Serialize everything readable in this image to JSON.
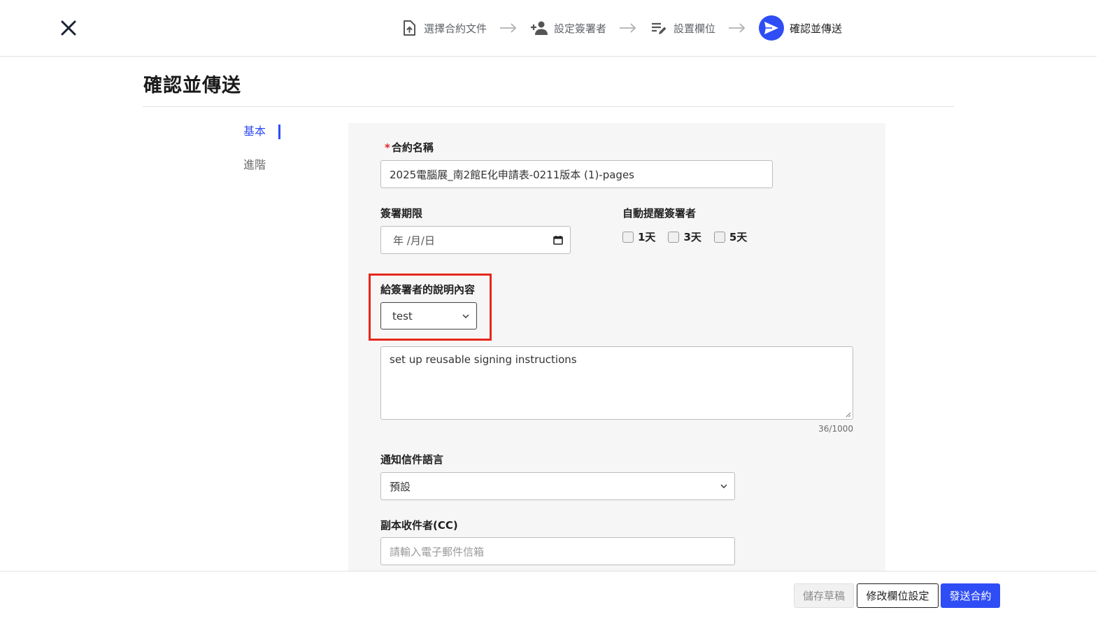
{
  "header": {
    "steps": [
      {
        "label": "選擇合約文件",
        "icon": "file-upload-icon"
      },
      {
        "label": "設定簽署者",
        "icon": "add-person-icon"
      },
      {
        "label": "設置欄位",
        "icon": "edit-list-icon"
      },
      {
        "label": "確認並傳送",
        "icon": "send-icon",
        "active": true
      }
    ]
  },
  "page": {
    "title": "確認並傳送"
  },
  "sidenav": {
    "items": [
      "基本",
      "進階"
    ],
    "active_index": 0
  },
  "form": {
    "contract_name": {
      "label": "合約名稱",
      "value": "2025電腦展_南2館E化申請表-0211版本 (1)-pages"
    },
    "deadline": {
      "label": "簽署期限",
      "placeholder": "年 /月/日"
    },
    "reminder": {
      "label": "自動提醒簽署者",
      "options": [
        "1天",
        "3天",
        "5天"
      ]
    },
    "instructions": {
      "label": "給簽署者的說明內容",
      "selected": "test",
      "text": "set up reusable signing instructions",
      "counter": "36/1000"
    },
    "language": {
      "label": "通知信件語言",
      "selected": "預設"
    },
    "cc": {
      "label": "副本收件者(CC)",
      "placeholder": "請輸入電子郵件信箱"
    }
  },
  "footer": {
    "save_draft": "儲存草稿",
    "edit_fields": "修改欄位設定",
    "send_contract": "發送合約"
  },
  "colors": {
    "accent": "#2f4df5",
    "highlight": "#e4281c",
    "required": "#e0262a"
  }
}
